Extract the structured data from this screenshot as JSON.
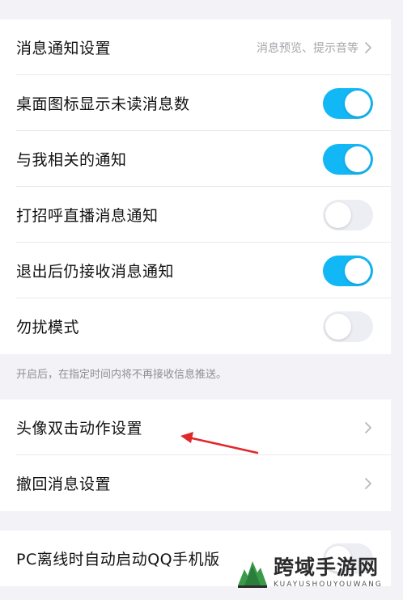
{
  "notification_group": {
    "rows": [
      {
        "label": "消息通知设置",
        "subtext": "消息预览、提示音等"
      },
      {
        "label": "桌面图标显示未读消息数",
        "toggle": "on"
      },
      {
        "label": "与我相关的通知",
        "toggle": "on"
      },
      {
        "label": "打招呼直播消息通知",
        "toggle": "off"
      },
      {
        "label": "退出后仍接收消息通知",
        "toggle": "on"
      },
      {
        "label": "勿扰模式",
        "toggle": "off"
      }
    ],
    "hint": "开启后，在指定时间内将不再接收信息推送。"
  },
  "action_group": {
    "rows": [
      {
        "label": "头像双击动作设置"
      },
      {
        "label": "撤回消息设置"
      }
    ]
  },
  "pc_group": {
    "rows": [
      {
        "label": "PC离线时自动启动QQ手机版",
        "toggle": "off"
      }
    ]
  },
  "watermark": {
    "title": "跨域手游网",
    "subtitle": "KUAYUSHOUYOUWANG"
  },
  "colors": {
    "toggle_on": "#12b7f5",
    "toggle_off": "#eceef3",
    "annotation_arrow": "#e0282c"
  }
}
